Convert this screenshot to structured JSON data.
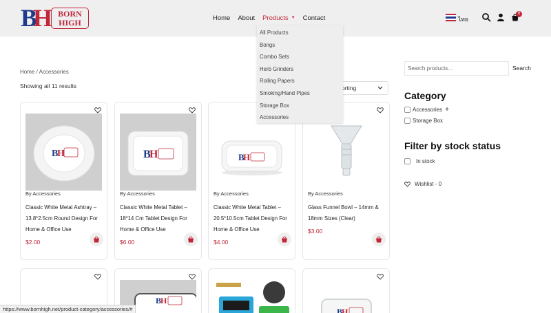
{
  "logo": {
    "bh_b": "B",
    "bh_h": "H",
    "line1": "BORN",
    "line2": "HIGH"
  },
  "nav": {
    "home": "Home",
    "about": "About",
    "products": "Products",
    "contact": "Contact"
  },
  "lang": {
    "label": "ไทย"
  },
  "cart": {
    "count": "0"
  },
  "dropdown": [
    "All Products",
    "Bongs",
    "Combo Sets",
    "Herb Grinders",
    "Rolling Papers",
    "Smoking/Hand Pipes",
    "Storage Box",
    "Accessories"
  ],
  "breadcrumb": {
    "home": "Home",
    "sep": " / ",
    "current": "Accessories"
  },
  "result_count": "Showing all 11 results",
  "sort": {
    "label": "orting"
  },
  "products": [
    {
      "cat": "By Accessories",
      "title": "Classic White Metal Ashtray – 13.8*2.5cm Round Design For Home & Office Use",
      "price": "$2.00"
    },
    {
      "cat": "By Accessories",
      "title": "Classic White Metal Tablet – 18*14 Cm Tablet Design For Home & Office Use",
      "price": "$6.00"
    },
    {
      "cat": "By Accessories",
      "title": "Classic White Metal Tablet – 20.5*10.5cm Tablet Design For Home & Office Use",
      "price": "$4.00"
    },
    {
      "cat": "By Accessories",
      "title": "Glass Funnel Bowl – 14mm & 18mm Sizes (Clear)",
      "price": "$3.00"
    }
  ],
  "sidebar": {
    "search_placeholder": "Search products...",
    "search_button": "Search",
    "category_heading": "Category",
    "categories": [
      "Accessories",
      "Storage Box"
    ],
    "stock_heading": "Filter by stock status",
    "in_stock": "In stock",
    "wishlist": "Wishlist - 0"
  },
  "status_bar": "https://www.bornhigh.net/product-category/accessories/#",
  "colors": {
    "accent": "#c0283a",
    "navy": "#1e3a8a",
    "header_bg": "#efefef"
  }
}
